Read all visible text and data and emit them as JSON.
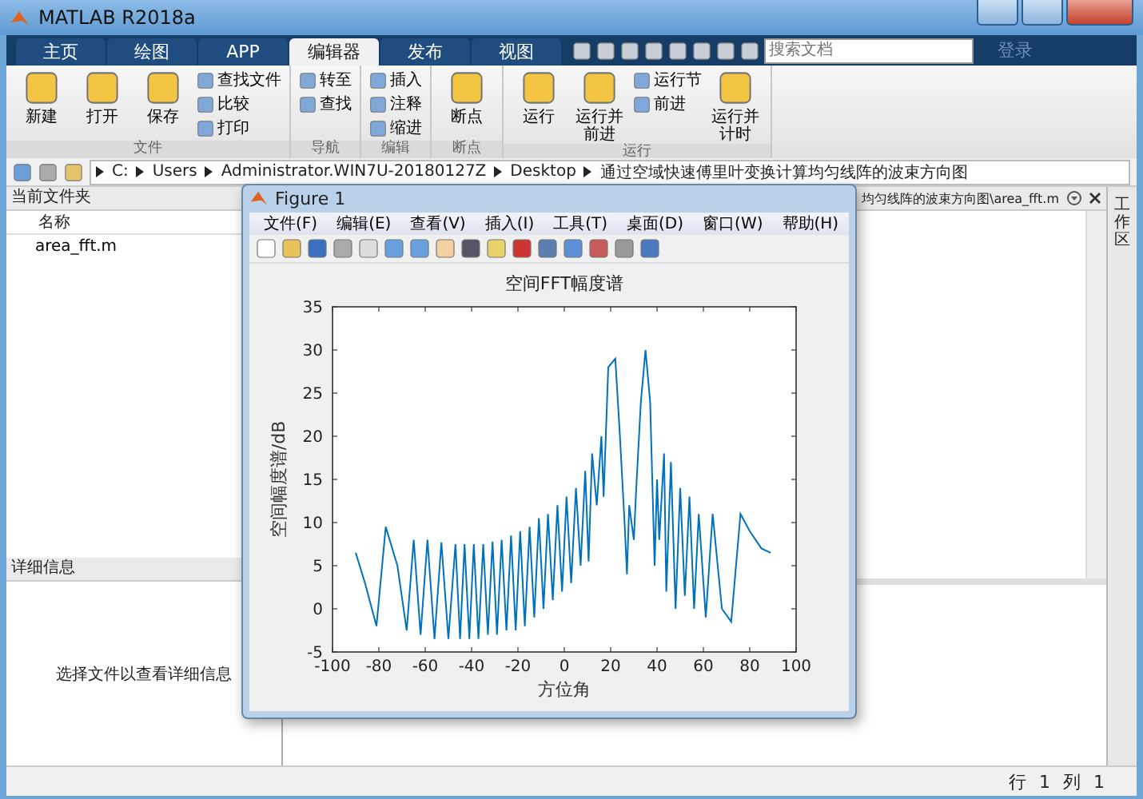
{
  "window": {
    "title": "MATLAB R2018a"
  },
  "tabs": [
    {
      "label": "主页",
      "selected": false
    },
    {
      "label": "绘图",
      "selected": false
    },
    {
      "label": "APP",
      "selected": false
    },
    {
      "label": "编辑器",
      "selected": true
    },
    {
      "label": "发布",
      "selected": false
    },
    {
      "label": "视图",
      "selected": false
    }
  ],
  "search": {
    "placeholder": "搜索文档"
  },
  "login": "登录",
  "toolstrip": {
    "groups": [
      {
        "label": "文件",
        "items": [
          {
            "label": "新建",
            "kind": "large"
          },
          {
            "label": "打开",
            "kind": "large"
          },
          {
            "label": "保存",
            "kind": "large"
          },
          {
            "label": "查找文件",
            "kind": "small"
          },
          {
            "label": "比较",
            "kind": "small"
          },
          {
            "label": "打印",
            "kind": "small"
          }
        ]
      },
      {
        "label": "导航",
        "items": [
          {
            "label": "转至",
            "kind": "small"
          },
          {
            "label": "查找",
            "kind": "small"
          }
        ]
      },
      {
        "label": "编辑",
        "items": [
          {
            "label": "插入",
            "kind": "small"
          },
          {
            "label": "注释",
            "kind": "small"
          },
          {
            "label": "缩进",
            "kind": "small"
          }
        ]
      },
      {
        "label": "断点",
        "items": [
          {
            "label": "断点",
            "kind": "large"
          }
        ]
      },
      {
        "label": "运行",
        "items": [
          {
            "label": "运行",
            "kind": "large"
          },
          {
            "label": "运行并前进",
            "kind": "large"
          },
          {
            "label": "运行节",
            "kind": "small"
          },
          {
            "label": "前进",
            "kind": "small"
          },
          {
            "label": "运行并计时",
            "kind": "large"
          }
        ]
      }
    ]
  },
  "address": {
    "segments": [
      "C:",
      "Users",
      "Administrator.WIN7U-20180127Z",
      "Desktop",
      "通过空域快速傅里叶变换计算均匀线阵的波束方向图"
    ]
  },
  "current_folder": {
    "title": "当前文件夹",
    "column": "名称",
    "files": [
      "area_fft.m"
    ]
  },
  "details": {
    "title": "详细信息",
    "message": "选择文件以查看详细信息"
  },
  "editor": {
    "tab_path": "均匀线阵的波束方向图\\area_fft.m"
  },
  "workspace": {
    "label": "工作区"
  },
  "status_bar": {
    "row_label": "行",
    "row": "1",
    "col_label": "列",
    "col": "1"
  },
  "figure": {
    "title": "Figure 1",
    "menus": [
      "文件(F)",
      "编辑(E)",
      "查看(V)",
      "插入(I)",
      "工具(T)",
      "桌面(D)",
      "窗口(W)",
      "帮助(H)"
    ],
    "chart_data": {
      "type": "line",
      "title": "空间FFT幅度谱",
      "xlabel": "方位角",
      "ylabel": "空间幅度谱/dB",
      "x": [
        -90,
        -86,
        -81,
        -77,
        -72,
        -68,
        -65,
        -62,
        -59,
        -56,
        -53,
        -50,
        -47,
        -45,
        -43,
        -41,
        -39,
        -37,
        -35,
        -33,
        -31,
        -29,
        -27,
        -25,
        -23,
        -21,
        -19,
        -17,
        -15,
        -13,
        -11,
        -9,
        -7,
        -5,
        -3,
        -1,
        1,
        3,
        5,
        7,
        9,
        10.5,
        12,
        14,
        16,
        17,
        19,
        22,
        24,
        26,
        27,
        28,
        30,
        31,
        33,
        35,
        37,
        39,
        40,
        41,
        43,
        44,
        46,
        48,
        50,
        52,
        54,
        56,
        58,
        61,
        64,
        68,
        72,
        76,
        80,
        85,
        89
      ],
      "series": [
        {
          "color": "#0072bd",
          "values": [
            6.5,
            3,
            -2,
            9.5,
            5,
            -2.5,
            8,
            -3,
            8,
            -3.5,
            7.7,
            -3.5,
            7.5,
            -3.5,
            7.5,
            -3.5,
            7.5,
            -3.5,
            7.5,
            -3,
            7.8,
            -3,
            8,
            -2.5,
            8.5,
            -2.5,
            9,
            -2,
            9.5,
            -1,
            10.5,
            0,
            11,
            1,
            12,
            2,
            13,
            3,
            14,
            5,
            16,
            5.5,
            18,
            12,
            20,
            13,
            28,
            29,
            20,
            10,
            4,
            12,
            8,
            14,
            24,
            30,
            24,
            5,
            15,
            8,
            18,
            2,
            17,
            0,
            14,
            1.5,
            13,
            0,
            11,
            -1,
            11,
            0,
            -1.5,
            11,
            9,
            7,
            6.5
          ]
        }
      ],
      "xlim": [
        -100,
        100
      ],
      "ylim": [
        -5,
        35
      ],
      "xticks": [
        -100,
        -80,
        -60,
        -40,
        -20,
        0,
        20,
        40,
        60,
        80,
        100
      ],
      "yticks": [
        -5,
        0,
        5,
        10,
        15,
        20,
        25,
        30,
        35
      ]
    }
  }
}
